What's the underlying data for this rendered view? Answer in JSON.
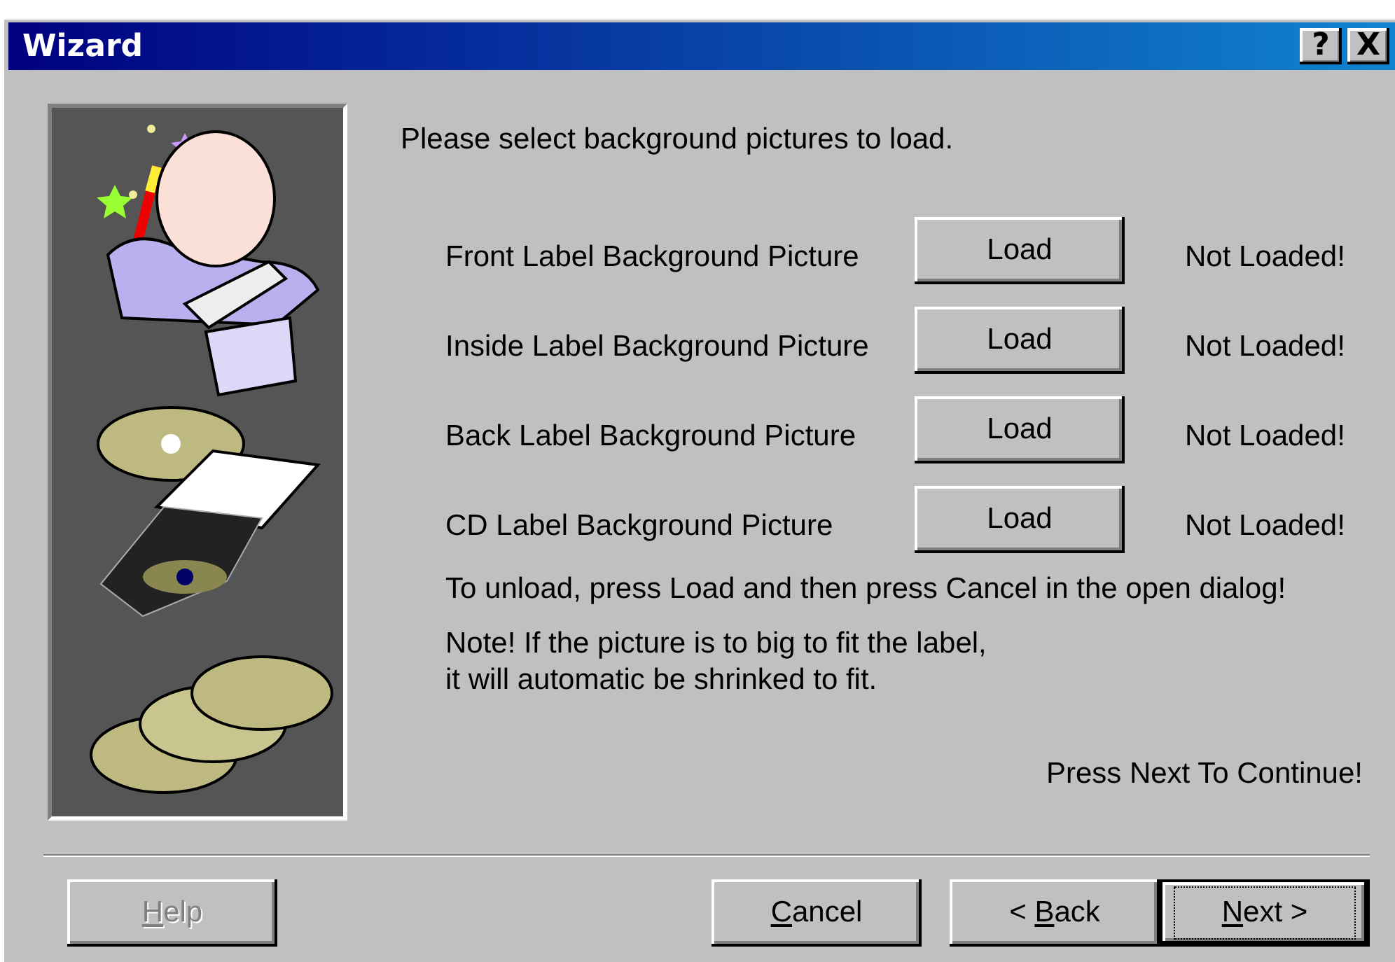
{
  "window": {
    "title": "Wizard",
    "title_buttons": [
      "?",
      "X"
    ]
  },
  "intro": "Please select background pictures to load.",
  "pictures": [
    {
      "label": "Front Label Background Picture",
      "button": "Load",
      "status": "Not Loaded!"
    },
    {
      "label": "Inside Label Background Picture",
      "button": "Load",
      "status": "Not Loaded!"
    },
    {
      "label": "Back Label Background Picture",
      "button": "Load",
      "status": "Not Loaded!"
    },
    {
      "label": "CD Label Background Picture",
      "button": "Load",
      "status": "Not Loaded!"
    }
  ],
  "unload_hint": "To unload, press Load and then press Cancel in the open dialog!",
  "note_lines": [
    "Note! If the picture is to big to fit the label,",
    "it will automatic be shrinked to fit."
  ],
  "continue_hint": "Press Next To Continue!",
  "buttons": [
    {
      "label_parts": [
        {
          "text": "H",
          "underlined": true
        },
        {
          "text": "elp",
          "underlined": false
        }
      ],
      "disabled": true,
      "default": false,
      "kind": "left"
    },
    {
      "label_parts": [
        {
          "text": "C",
          "underlined": true
        },
        {
          "text": "ancel",
          "underlined": false
        }
      ],
      "disabled": false,
      "default": false,
      "kind": "right"
    },
    {
      "label_parts": [
        {
          "text": "< ",
          "underlined": false
        },
        {
          "text": "B",
          "underlined": true
        },
        {
          "text": "ack",
          "underlined": false
        }
      ],
      "disabled": false,
      "default": false,
      "kind": "right"
    },
    {
      "label_parts": [
        {
          "text": "N",
          "underlined": true
        },
        {
          "text": "ext >",
          "underlined": false
        }
      ],
      "disabled": false,
      "default": true,
      "kind": "right"
    }
  ]
}
